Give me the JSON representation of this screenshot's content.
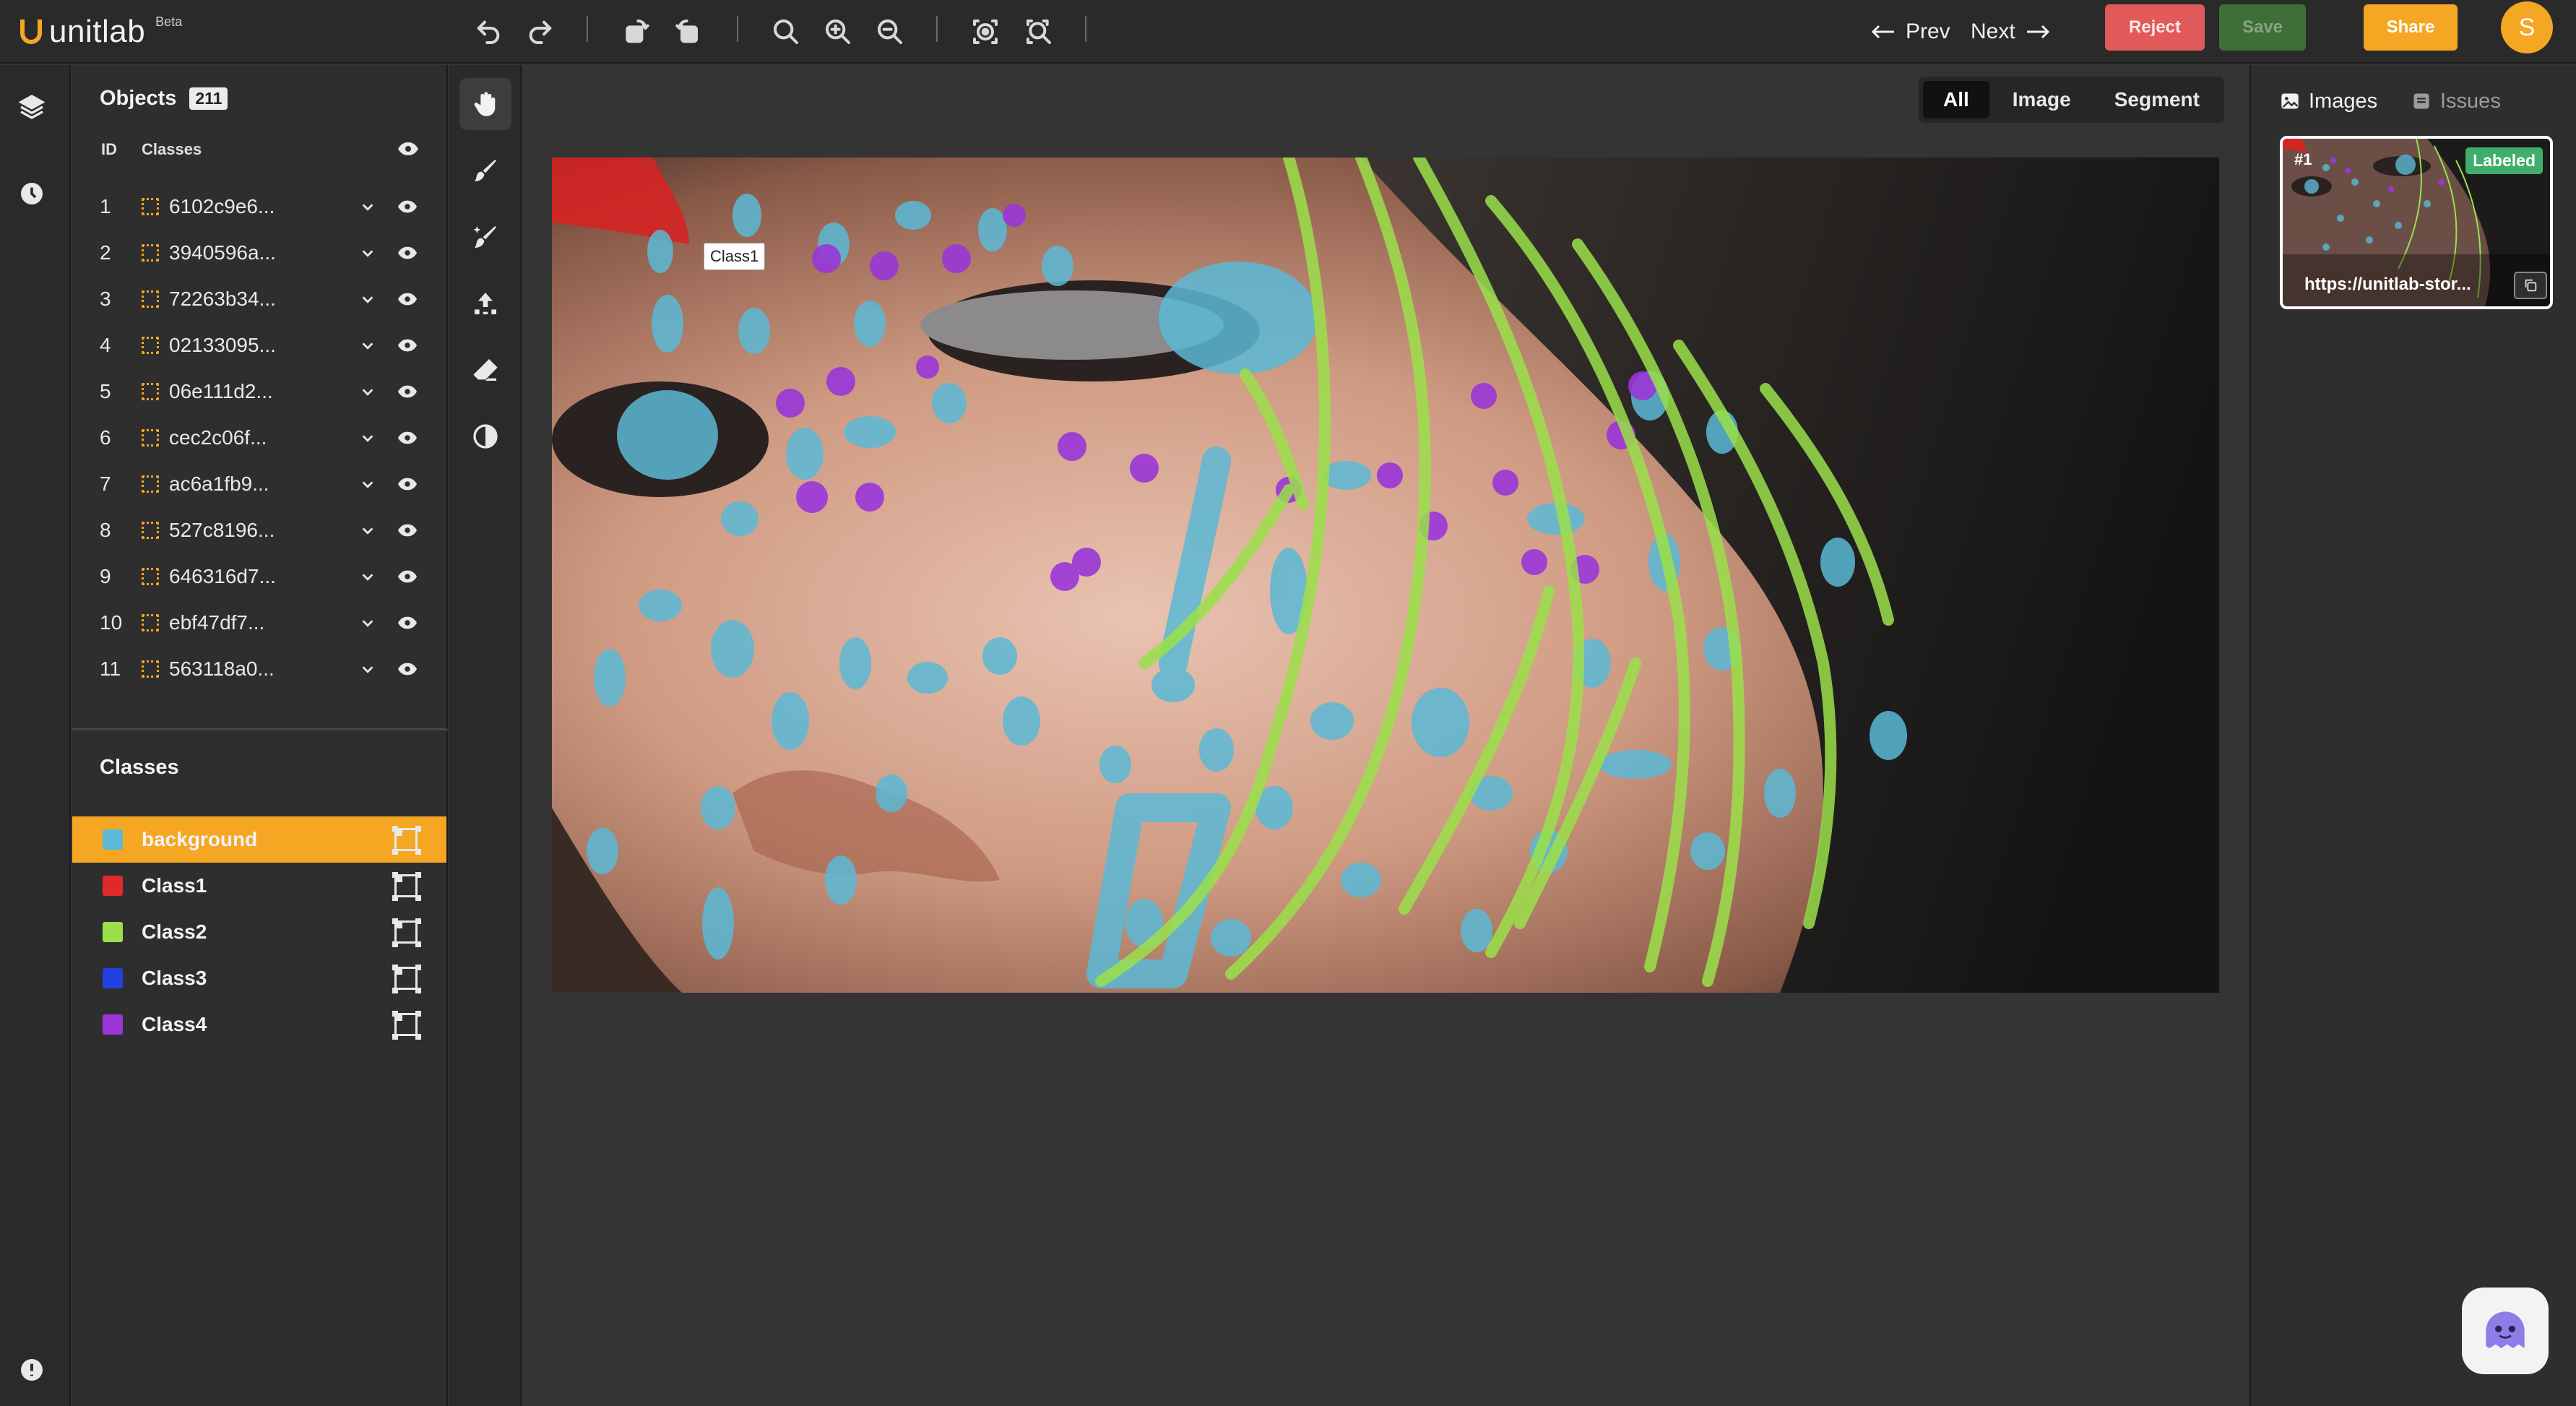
{
  "app": {
    "brand": "unitlab",
    "beta_label": "Beta",
    "accent": "#f5a623"
  },
  "toolbar": {
    "icons": [
      "undo-icon",
      "redo-icon",
      "rotate-left-icon",
      "rotate-right-icon",
      "zoom-fit-icon",
      "zoom-in-icon",
      "zoom-out-icon",
      "auto-annotate-icon",
      "auto-segment-icon"
    ],
    "prev_label": "Prev",
    "next_label": "Next",
    "reject_label": "Reject",
    "save_label": "Save",
    "share_label": "Share",
    "user_initial": "S",
    "colors": {
      "reject": "#e05a5a",
      "save": "#3f6e39",
      "share": "#f5a623"
    }
  },
  "rail": {
    "icons": [
      "layers-icon",
      "history-icon",
      "info-icon"
    ]
  },
  "objects": {
    "title": "Objects",
    "count": "211",
    "col_id": "ID",
    "col_classes": "Classes",
    "items": [
      {
        "id": "1",
        "name": "6102c9e6..."
      },
      {
        "id": "2",
        "name": "3940596a..."
      },
      {
        "id": "3",
        "name": "72263b34..."
      },
      {
        "id": "4",
        "name": "02133095..."
      },
      {
        "id": "5",
        "name": "06e111d2..."
      },
      {
        "id": "6",
        "name": "cec2c06f..."
      },
      {
        "id": "7",
        "name": "ac6a1fb9..."
      },
      {
        "id": "8",
        "name": "527c8196..."
      },
      {
        "id": "9",
        "name": "646316d7..."
      },
      {
        "id": "10",
        "name": "ebf47df7..."
      },
      {
        "id": "11",
        "name": "563118a0..."
      }
    ]
  },
  "classes": {
    "title": "Classes",
    "items": [
      {
        "name": "background",
        "color": "#5bb9d6",
        "active": true
      },
      {
        "name": "Class1",
        "color": "#e02a2a",
        "active": false
      },
      {
        "name": "Class2",
        "color": "#9be04a",
        "active": false
      },
      {
        "name": "Class3",
        "color": "#2340e0",
        "active": false
      },
      {
        "name": "Class4",
        "color": "#9a36d8",
        "active": false
      }
    ]
  },
  "tools": [
    "hand-icon",
    "brush-icon",
    "magic-brush-icon",
    "smart-select-icon",
    "eraser-icon",
    "contrast-icon"
  ],
  "canvas": {
    "tabs": [
      "All",
      "Image",
      "Segment"
    ],
    "active_tab": "All",
    "tooltip_label": "Class1"
  },
  "right_panel": {
    "tab_images": "Images",
    "tab_issues": "Issues",
    "thumb_number": "#1",
    "thumb_status": "Labeled",
    "thumb_url": "https://unitlab-stor..."
  }
}
